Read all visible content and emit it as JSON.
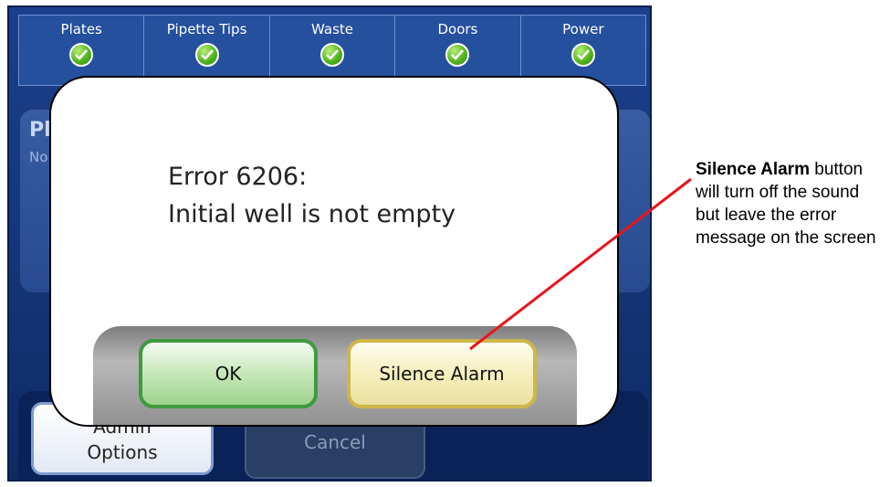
{
  "status_bar": {
    "items": [
      {
        "label": "Plates",
        "icon": "check-circle-icon"
      },
      {
        "label": "Pipette Tips",
        "icon": "check-circle-icon"
      },
      {
        "label": "Waste",
        "icon": "check-circle-icon"
      },
      {
        "label": "Doors",
        "icon": "check-circle-icon"
      },
      {
        "label": "Power",
        "icon": "check-circle-icon"
      }
    ]
  },
  "background": {
    "title_fragment": "Pl",
    "subtitle_fragment": "No",
    "admin_label_line1": "Admin",
    "admin_label_line2": "Options",
    "cancel_label": "Cancel"
  },
  "dialog": {
    "error_line1": "Error 6206:",
    "error_line2": "Initial well is not empty",
    "ok_label": "OK",
    "silence_label": "Silence Alarm"
  },
  "callout": {
    "title": "Silence Alarm",
    "body": "button will turn off the sound but leave the error message on the screen"
  },
  "colors": {
    "screen_blue": "#143577",
    "ok_border": "#3f9a3f",
    "silence_border": "#cfb64a",
    "callout_line": "#e8141c"
  }
}
